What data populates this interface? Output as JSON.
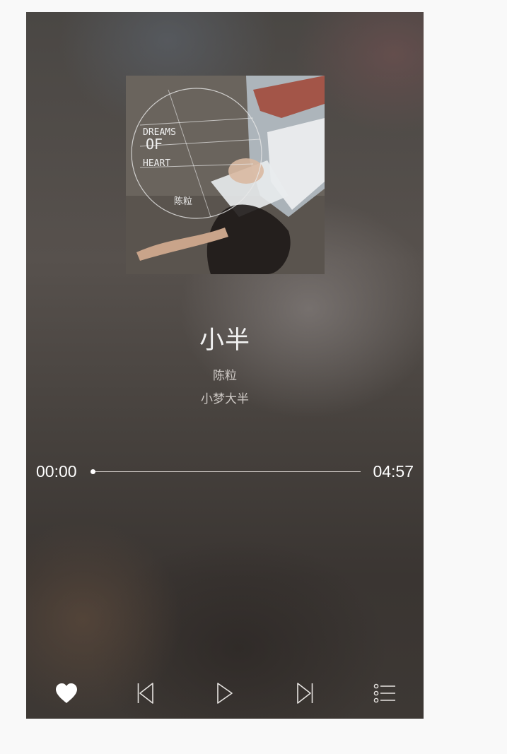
{
  "song": {
    "title": "小半",
    "artist": "陈粒",
    "album": "小梦大半"
  },
  "cover_art": {
    "text_lines": [
      "DREAMS",
      "OF",
      "HEART"
    ],
    "signature": "陈粒"
  },
  "playback": {
    "current_time": "00:00",
    "total_time": "04:57",
    "progress_fraction": 0,
    "liked": true
  },
  "controls": {
    "like_icon": "heart-icon",
    "prev_icon": "skip-previous-icon",
    "play_icon": "play-icon",
    "next_icon": "skip-next-icon",
    "playlist_icon": "playlist-icon"
  },
  "colors": {
    "foreground": "#ffffff",
    "secondary_text": "#cfcac6"
  }
}
